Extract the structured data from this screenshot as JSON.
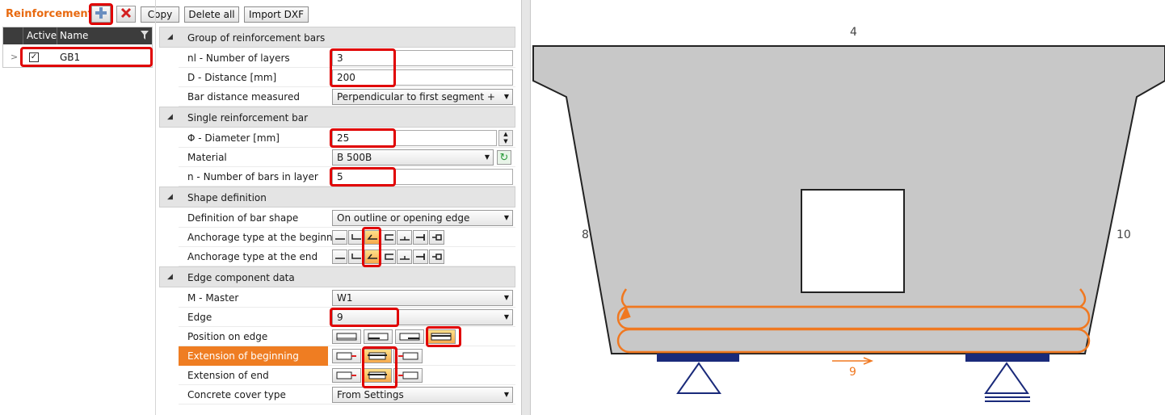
{
  "toolbar": {
    "title": "Reinforcement",
    "add_icon": "add-plus-icon",
    "delete_icon": "delete-x-icon",
    "copy_label": "Copy",
    "delete_all_label": "Delete all",
    "import_dxf_label": "Import DXF"
  },
  "grid": {
    "headers": [
      "Active",
      "Name"
    ],
    "rows": [
      {
        "active": true,
        "name": "GB1"
      }
    ]
  },
  "sections": {
    "group": "Group of reinforcement bars",
    "single": "Single reinforcement bar",
    "shape": "Shape definition",
    "edge": "Edge component data"
  },
  "props": {
    "layers": {
      "label": "nl - Number of layers",
      "value": "3"
    },
    "distance": {
      "label": "D - Distance [mm]",
      "value": "200"
    },
    "measured": {
      "label": "Bar distance measured",
      "value": "Perpendicular to first segment +"
    },
    "diameter": {
      "label": "Φ - Diameter [mm]",
      "value": "25"
    },
    "material": {
      "label": "Material",
      "value": "B 500B"
    },
    "bars": {
      "label": "n - Number of bars in layer",
      "value": "5"
    },
    "bar_shape": {
      "label": "Definition of bar shape",
      "value": "On outline or opening edge"
    },
    "anch_begin": {
      "label": "Anchorage type at the beginning"
    },
    "anch_end": {
      "label": "Anchorage type at the end"
    },
    "master": {
      "label": "M - Master",
      "value": "W1"
    },
    "edge": {
      "label": "Edge",
      "value": "9"
    },
    "position": {
      "label": "Position on edge"
    },
    "ext_begin": {
      "label": "Extension of beginning"
    },
    "ext_end": {
      "label": "Extension of end"
    },
    "cover": {
      "label": "Concrete cover type",
      "value": "From Settings"
    }
  },
  "drawing": {
    "edge_labels": {
      "top": "4",
      "left": "8",
      "right": "10",
      "bottom": "9"
    },
    "colors": {
      "section": "#c8c8c8",
      "reinforcement": "#f07820",
      "support": "#1a2a7a",
      "selection": "#e00000",
      "highlight": "#ef7d22"
    }
  }
}
